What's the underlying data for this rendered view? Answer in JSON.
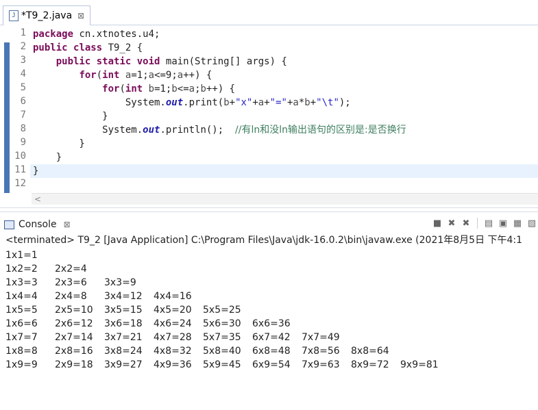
{
  "editor_tab": {
    "title": "*T9_2.java",
    "icon": "java-file-icon",
    "close": "⊠"
  },
  "lines": [
    {
      "n": "1",
      "code": "package cn.xtnotes.u4;"
    },
    {
      "n": "2",
      "code": "public class T9_2 {"
    },
    {
      "n": "3",
      "code": "    public static void main(String[] args) {"
    },
    {
      "n": "4",
      "code": "        for(int a=1;a<=9;a++) {"
    },
    {
      "n": "5",
      "code": "            for(int b=1;b<=a;b++) {"
    },
    {
      "n": "6",
      "code": "                System.out.print(b+\"x\"+a+\"=\"+a*b+\"\\t\");"
    },
    {
      "n": "7",
      "code": "            }"
    },
    {
      "n": "8",
      "code": "            System.out.println();  //有ln和没ln输出语句的区别是:是否换行"
    },
    {
      "n": "9",
      "code": "        }"
    },
    {
      "n": "10",
      "code": "    }"
    },
    {
      "n": "11",
      "code": "}"
    },
    {
      "n": "12",
      "code": ""
    }
  ],
  "console": {
    "tab_label": "Console",
    "status": "<terminated> T9_2 [Java Application] C:\\Program Files\\Java\\jdk-16.0.2\\bin\\javaw.exe (2021年8月5日 下午4:1",
    "rows": [
      [
        "1x1=1"
      ],
      [
        "1x2=2",
        "2x2=4"
      ],
      [
        "1x3=3",
        "2x3=6",
        "3x3=9"
      ],
      [
        "1x4=4",
        "2x4=8",
        "3x4=12",
        "4x4=16"
      ],
      [
        "1x5=5",
        "2x5=10",
        "3x5=15",
        "4x5=20",
        "5x5=25"
      ],
      [
        "1x6=6",
        "2x6=12",
        "3x6=18",
        "4x6=24",
        "5x6=30",
        "6x6=36"
      ],
      [
        "1x7=7",
        "2x7=14",
        "3x7=21",
        "4x7=28",
        "5x7=35",
        "6x7=42",
        "7x7=49"
      ],
      [
        "1x8=8",
        "2x8=16",
        "3x8=24",
        "4x8=32",
        "5x8=40",
        "6x8=48",
        "7x8=56",
        "8x8=64"
      ],
      [
        "1x9=9",
        "2x9=18",
        "3x9=27",
        "4x9=36",
        "5x9=45",
        "6x9=54",
        "7x9=63",
        "8x9=72",
        "9x9=81"
      ]
    ],
    "toolbar_icons": [
      "terminate-icon",
      "remove-launch-icon",
      "remove-all-icon",
      "clear-console-icon",
      "scroll-lock-icon",
      "word-wrap-icon",
      "pin-console-icon"
    ]
  }
}
